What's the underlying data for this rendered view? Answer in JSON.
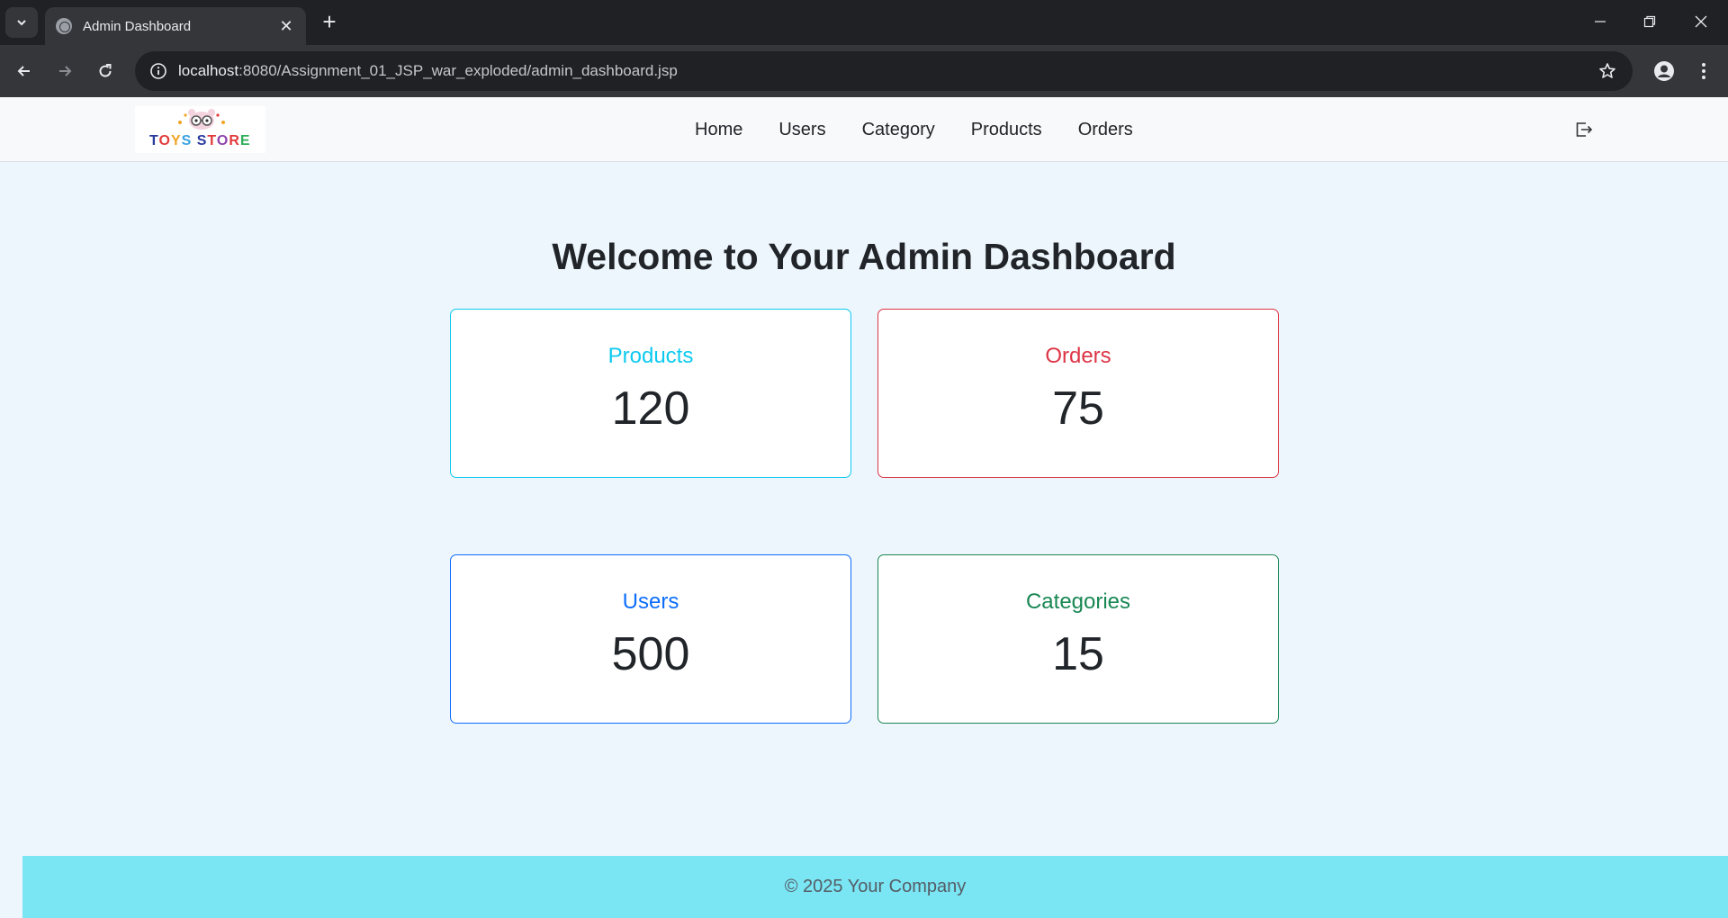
{
  "browser": {
    "tab_title": "Admin Dashboard",
    "url_host": "localhost",
    "url_rest": ":8080/Assignment_01_JSP_war_exploded/admin_dashboard.jsp",
    "close_glyph": "✕",
    "new_tab_glyph": "+",
    "icons": [
      "tab-list-icon",
      "globe-icon",
      "back-icon",
      "forward-icon",
      "reload-icon",
      "site-info-icon",
      "star-icon",
      "profile-icon",
      "more-icon",
      "minimize-icon",
      "restore-icon",
      "close-icon"
    ]
  },
  "site": {
    "logo": {
      "letters": [
        {
          "ch": "T",
          "color": "#2b3a9e"
        },
        {
          "ch": "O",
          "color": "#e23b3b"
        },
        {
          "ch": "Y",
          "color": "#f2a524"
        },
        {
          "ch": "S",
          "color": "#3aa3e0"
        },
        {
          "ch": " ",
          "color": "#000000"
        },
        {
          "ch": "S",
          "color": "#2b3a9e"
        },
        {
          "ch": "T",
          "color": "#e23b3b"
        },
        {
          "ch": "O",
          "color": "#8e44ad"
        },
        {
          "ch": "R",
          "color": "#e23b3b"
        },
        {
          "ch": "E",
          "color": "#2fae5a"
        }
      ]
    },
    "nav": [
      "Home",
      "Users",
      "Category",
      "Products",
      "Orders"
    ],
    "logout_icon": "logout-icon"
  },
  "main": {
    "title": "Welcome to Your Admin Dashboard",
    "cards": [
      {
        "label": "Products",
        "value": "120",
        "color": "#0dcaf0"
      },
      {
        "label": "Orders",
        "value": "75",
        "color": "#dc3545"
      },
      {
        "label": "Users",
        "value": "500",
        "color": "#0d6efd"
      },
      {
        "label": "Categories",
        "value": "15",
        "color": "#198754"
      }
    ]
  },
  "footer": {
    "text": "© 2025 Your Company"
  }
}
